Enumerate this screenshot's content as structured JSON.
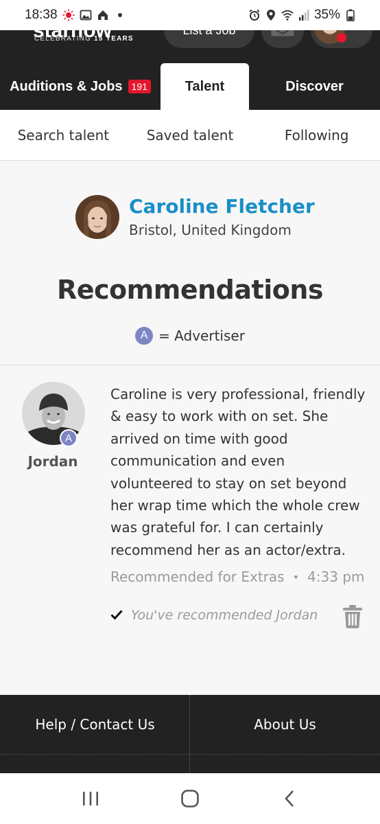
{
  "status_bar": {
    "time": "18:38",
    "battery": "35%"
  },
  "header": {
    "logo_text": "starnow",
    "logo_tagline": "CELEBRATING",
    "logo_tagline_bold": "15 YEARS",
    "list_job_label": "List a Job"
  },
  "tabs": [
    {
      "label": "Auditions & Jobs",
      "badge": "191"
    },
    {
      "label": "Talent"
    },
    {
      "label": "Discover"
    }
  ],
  "subnav": [
    {
      "label": "Search talent"
    },
    {
      "label": "Saved talent"
    },
    {
      "label": "Following"
    }
  ],
  "profile": {
    "name": "Caroline Fletcher",
    "location": "Bristol, United Kingdom"
  },
  "page_title": "Recommendations",
  "legend": {
    "badge_letter": "A",
    "text": "= Advertiser"
  },
  "recommendation": {
    "author": "Jordan",
    "author_badge": "A",
    "text": "Caroline is very professional, friendly & easy to work with on set. She arrived on time with good communication and even volunteered to stay on set beyond her wrap time which the whole crew was grateful for. I can certainly recommend her as an actor/extra.",
    "category": "Recommended for Extras",
    "separator": "•",
    "time": "4:33 pm",
    "status": "You've recommended Jordan"
  },
  "footer": {
    "help": "Help / Contact Us",
    "about": "About Us"
  },
  "colors": {
    "header_bg": "#222222",
    "name_blue": "#1a8fc7",
    "badge_red": "#e3172d",
    "advertiser_purple": "#7c86c4"
  }
}
